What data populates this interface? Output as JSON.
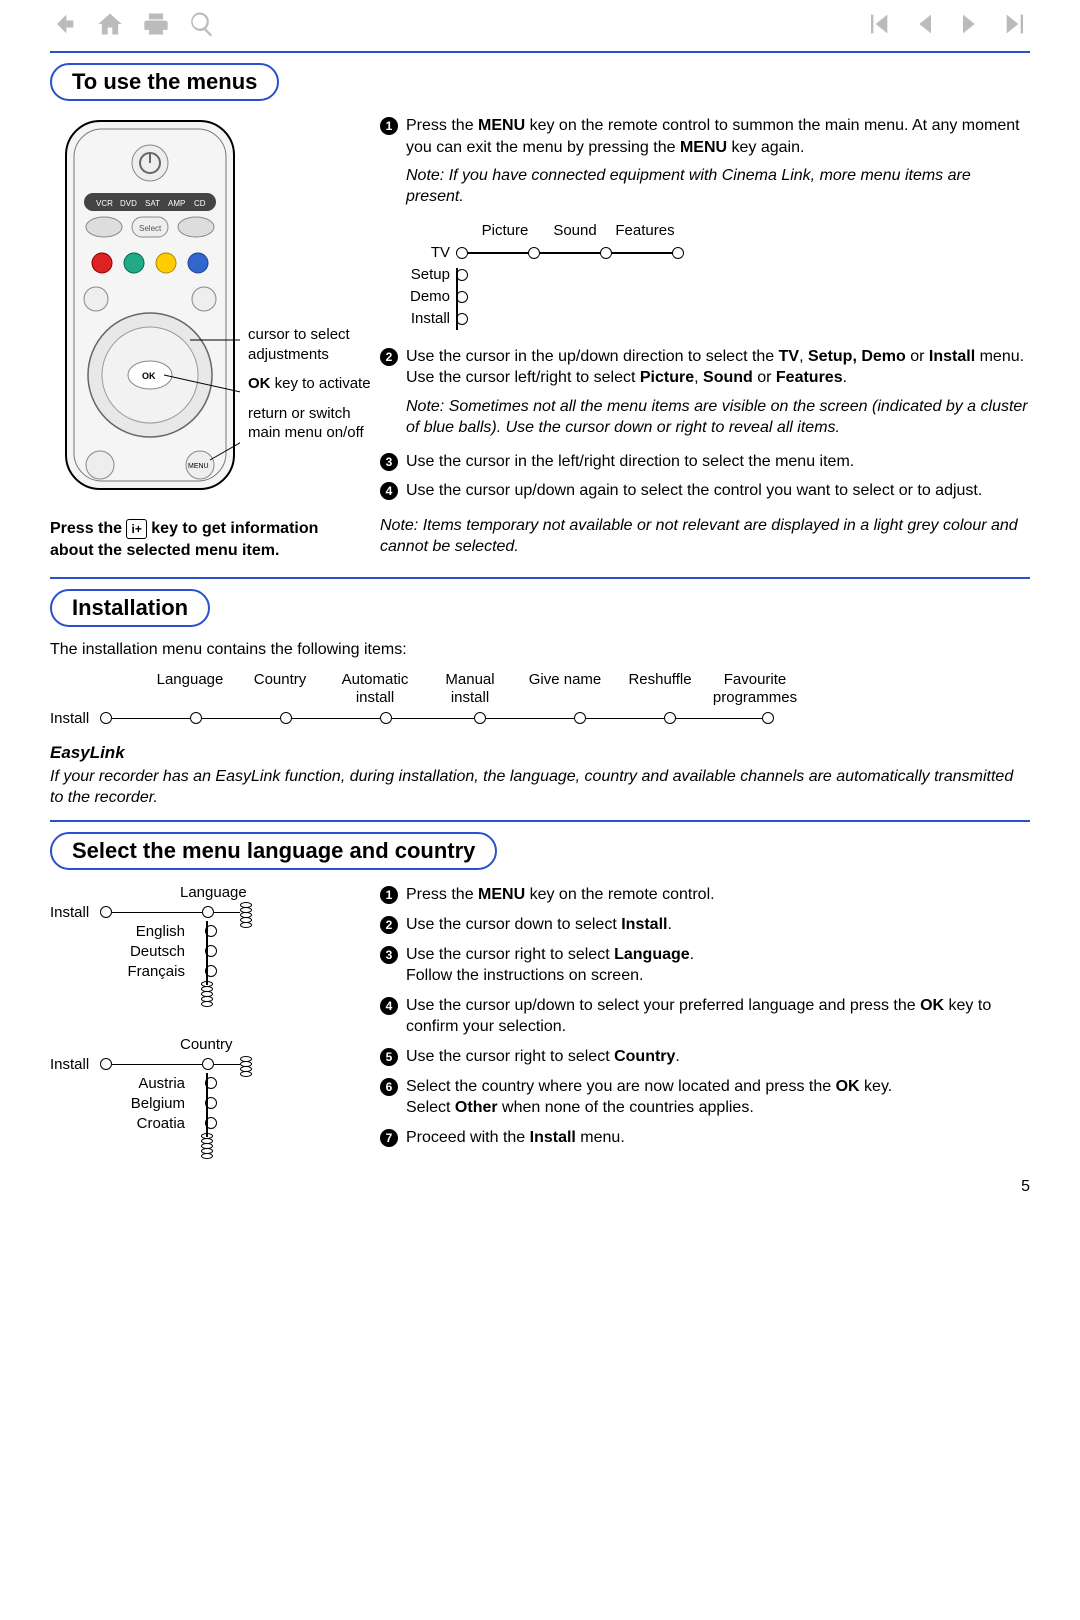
{
  "page_number": "5",
  "section1": {
    "title": "To use the menus",
    "callouts": {
      "c1_a": "cursor to select",
      "c1_b": "adjustments",
      "c2_a": "OK",
      "c2_b": " key to activate",
      "c3_a": "return or switch",
      "c3_b": "main menu on/off"
    },
    "press_note_a": "Press the ",
    "press_note_icon": "i+",
    "press_note_b": " key to get information about the selected menu item.",
    "steps": [
      {
        "n": "1",
        "parts": [
          "Press the ",
          "MENU",
          " key on the remote control to summon the main menu. At any moment you can exit the menu by pressing the ",
          "MENU",
          " key again."
        ]
      },
      {
        "n": "2",
        "parts": [
          "Use the cursor in the up/down direction to select the ",
          "TV",
          ", ",
          "Setup, Demo",
          " or ",
          "Install",
          " menu.",
          "\n",
          "Use the cursor left/right to select ",
          "Picture",
          ", ",
          "Sound",
          " or ",
          "Features",
          "."
        ]
      },
      {
        "n": "3",
        "parts": [
          "Use the cursor in the left/right direction to select the menu item."
        ]
      },
      {
        "n": "4",
        "parts": [
          "Use the cursor up/down again to select the control you want to select or to adjust."
        ]
      }
    ],
    "note1": "Note: If you have connected equipment with Cinema Link, more menu items are present.",
    "note2": "Note: Sometimes not all the menu items are visible on the screen (indicated by a cluster of blue balls). Use the cursor down or right to reveal all items.",
    "note3": "Note: Items temporary not available or not relevant are displayed in a light grey colour and cannot be selected.",
    "menu_diagram": {
      "top": [
        "Picture",
        "Sound",
        "Features"
      ],
      "side": [
        "TV",
        "Setup",
        "Demo",
        "Install"
      ]
    }
  },
  "section2": {
    "title": "Installation",
    "intro": "The installation menu contains the following items:",
    "items": [
      "Language",
      "Country",
      "Automatic install",
      "Manual install",
      "Give name",
      "Reshuffle",
      "Favourite programmes"
    ],
    "root": "Install",
    "easylink_h": "EasyLink",
    "easylink_text": "If your recorder has an EasyLink function, during installation, the language, country and available channels are automatically transmitted to the recorder."
  },
  "section3": {
    "title": "Select the menu language and country",
    "diag1": {
      "root": "Install",
      "head": "Language",
      "items": [
        "English",
        "Deutsch",
        "Français"
      ]
    },
    "diag2": {
      "root": "Install",
      "head": "Country",
      "items": [
        "Austria",
        "Belgium",
        "Croatia"
      ]
    },
    "steps": [
      {
        "n": "1",
        "parts": [
          "Press the ",
          "MENU",
          " key on the remote control."
        ]
      },
      {
        "n": "2",
        "parts": [
          "Use the cursor down to select ",
          "Install",
          "."
        ]
      },
      {
        "n": "3",
        "parts": [
          "Use the cursor right to select ",
          "Language",
          ".",
          "\n",
          "Follow the instructions on screen."
        ]
      },
      {
        "n": "4",
        "parts": [
          "Use the cursor up/down to select your preferred language and press the ",
          "OK",
          " key to confirm your selection."
        ]
      },
      {
        "n": "5",
        "parts": [
          "Use the cursor right to select ",
          "Country",
          "."
        ]
      },
      {
        "n": "6",
        "parts": [
          "Select the country where you are now located and press the ",
          "OK",
          " key.",
          "\n",
          "Select ",
          "Other",
          " when none of the countries applies."
        ]
      },
      {
        "n": "7",
        "parts": [
          "Proceed with the ",
          "Install",
          " menu."
        ]
      }
    ]
  },
  "remote": {
    "labels": [
      "VCR",
      "DVD",
      "SAT",
      "AMP",
      "CD"
    ],
    "select": "Select",
    "ok": "OK",
    "menu": "MENU"
  }
}
